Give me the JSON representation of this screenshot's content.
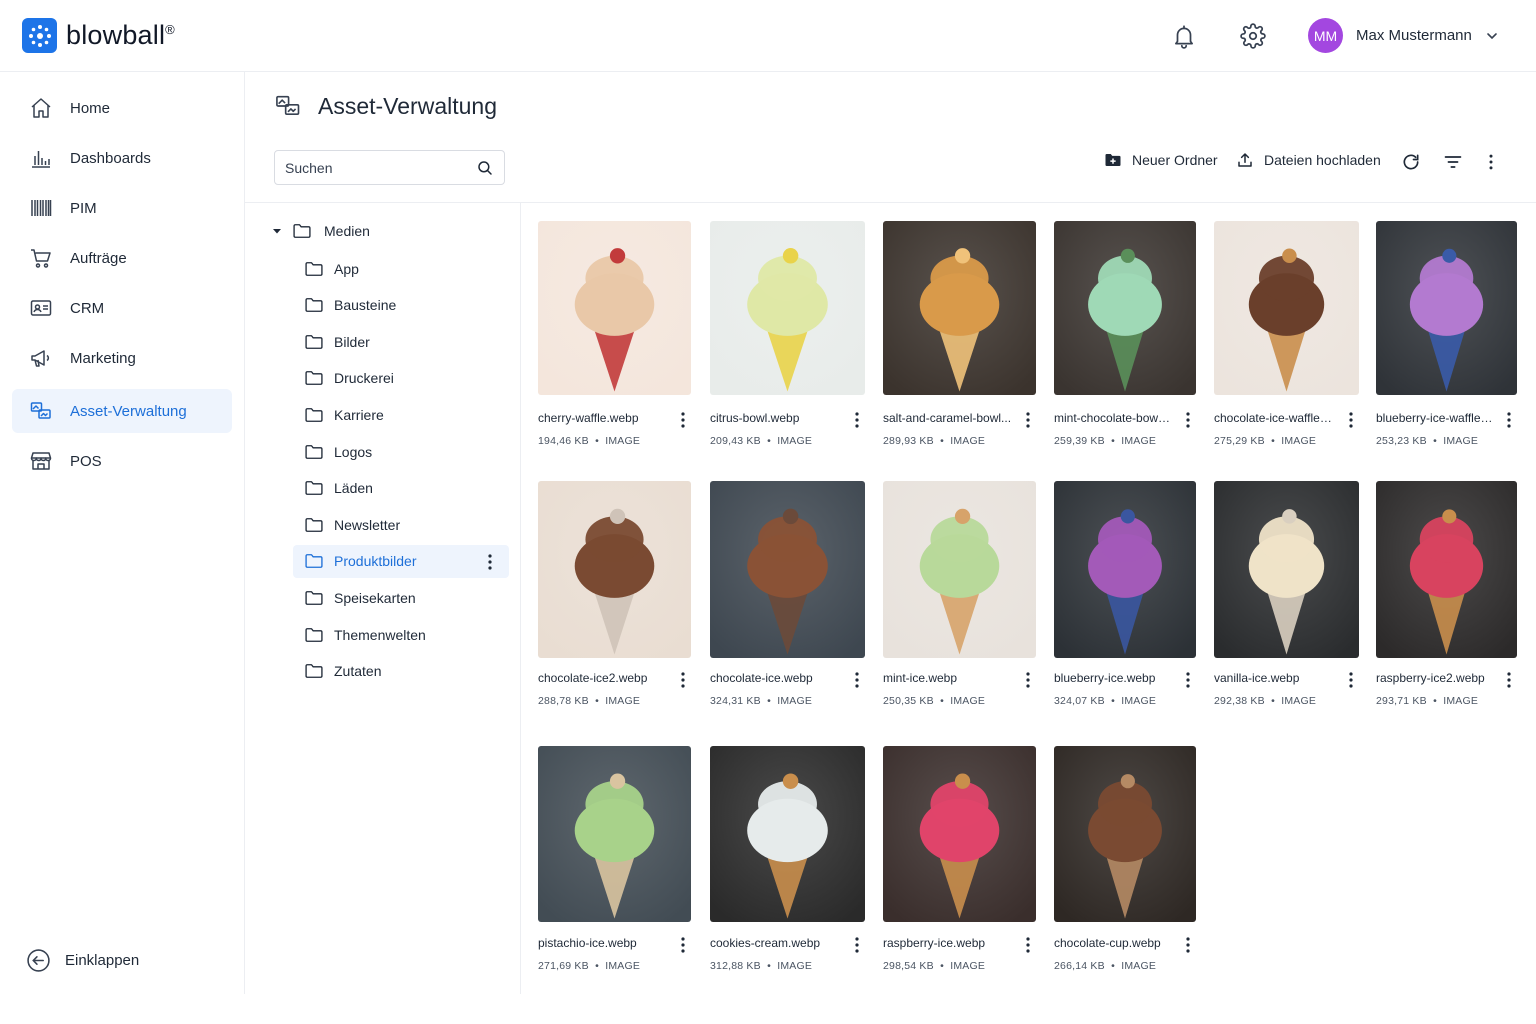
{
  "brand": {
    "name": "blowball",
    "mark": "®"
  },
  "user": {
    "initials": "MM",
    "name": "Max Mustermann"
  },
  "sidebar": {
    "items": [
      {
        "label": "Home",
        "icon": "home-icon"
      },
      {
        "label": "Dashboards",
        "icon": "chart-bars-icon"
      },
      {
        "label": "PIM",
        "icon": "barcode-icon"
      },
      {
        "label": "Aufträge",
        "icon": "cart-icon"
      },
      {
        "label": "CRM",
        "icon": "contact-card-icon"
      },
      {
        "label": "Marketing",
        "icon": "megaphone-icon"
      },
      {
        "label": "Asset-Verwaltung",
        "icon": "assets-icon",
        "active": true
      },
      {
        "label": "POS",
        "icon": "store-icon"
      }
    ],
    "collapse_label": "Einklappen"
  },
  "page": {
    "title": "Asset-Verwaltung"
  },
  "search": {
    "placeholder": "Suchen"
  },
  "toolbar": {
    "new_folder": "Neuer Ordner",
    "upload": "Dateien hochladen"
  },
  "tree": {
    "root": "Medien",
    "folders": [
      "App",
      "Bausteine",
      "Bilder",
      "Druckerei",
      "Karriere",
      "Logos",
      "Läden",
      "Newsletter",
      "Produktbilder",
      "Speisekarten",
      "Themenwelten",
      "Zutaten"
    ],
    "active": "Produktbilder"
  },
  "assets": [
    {
      "name": "cherry-waffle.webp",
      "size": "194,46 KB",
      "type": "IMAGE"
    },
    {
      "name": "citrus-bowl.webp",
      "size": "209,43 KB",
      "type": "IMAGE"
    },
    {
      "name": "salt-and-caramel-bowl...",
      "size": "289,93 KB",
      "type": "IMAGE"
    },
    {
      "name": "mint-chocolate-bowl.we...",
      "size": "259,39 KB",
      "type": "IMAGE"
    },
    {
      "name": "chocolate-ice-waffle.webp",
      "size": "275,29 KB",
      "type": "IMAGE"
    },
    {
      "name": "blueberry-ice-waffle.webp",
      "size": "253,23 KB",
      "type": "IMAGE"
    },
    {
      "name": "chocolate-ice2.webp",
      "size": "288,78 KB",
      "type": "IMAGE"
    },
    {
      "name": "chocolate-ice.webp",
      "size": "324,31 KB",
      "type": "IMAGE"
    },
    {
      "name": "mint-ice.webp",
      "size": "250,35 KB",
      "type": "IMAGE"
    },
    {
      "name": "blueberry-ice.webp",
      "size": "324,07 KB",
      "type": "IMAGE"
    },
    {
      "name": "vanilla-ice.webp",
      "size": "292,38 KB",
      "type": "IMAGE"
    },
    {
      "name": "raspberry-ice2.webp",
      "size": "293,71 KB",
      "type": "IMAGE"
    },
    {
      "name": "pistachio-ice.webp",
      "size": "271,69 KB",
      "type": "IMAGE"
    },
    {
      "name": "cookies-cream.webp",
      "size": "312,88 KB",
      "type": "IMAGE"
    },
    {
      "name": "raspberry-ice.webp",
      "size": "298,54 KB",
      "type": "IMAGE"
    },
    {
      "name": "chocolate-cup.webp",
      "size": "266,14 KB",
      "type": "IMAGE"
    }
  ],
  "colors": {
    "accent": "#1d6fd8",
    "avatar": "#a347e0",
    "active_bg": "#eef4fd"
  }
}
